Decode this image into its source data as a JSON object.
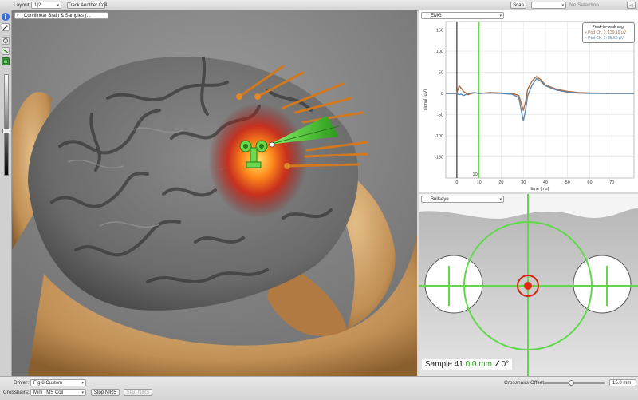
{
  "toolbar": {
    "layout_label": "Layout:",
    "layout_value": "1|2",
    "track_button": "Track Another Coil",
    "scan_button": "Scan",
    "scan_select": "",
    "selection_status": "No Selection"
  },
  "viewport": {
    "view_select": "Curvilinear Brain & Samples (..."
  },
  "emg": {
    "view_select": "EMG",
    "ylabel": "signal (μV)",
    "xlabel": "time (ms)",
    "marker_label": "10",
    "legend_title": "Peak-to-peak avg.",
    "legend_ch1": "Pod Ch. 1: 139.16 μV",
    "legend_ch2": "Pod Ch. 2: 85.59 μV"
  },
  "chart_data": {
    "type": "line",
    "title": "",
    "xlabel": "time (ms)",
    "ylabel": "signal (μV)",
    "xlim": [
      -5,
      80
    ],
    "ylim": [
      -200,
      170
    ],
    "xticks": [
      0,
      10,
      20,
      30,
      40,
      50,
      60,
      70
    ],
    "yticks": [
      150,
      100,
      50,
      0,
      -50,
      -100,
      -150
    ],
    "marker_x": 10,
    "grid": true,
    "legend_position": "top-right",
    "series": [
      {
        "name": "Pod Ch. 1",
        "color": "#b06a3a",
        "x": [
          -5,
          -1,
          0,
          1,
          2,
          3,
          5,
          8,
          10,
          15,
          20,
          25,
          28,
          30,
          31,
          32,
          34,
          36,
          38,
          40,
          45,
          50,
          55,
          60,
          70,
          80
        ],
        "y": [
          0,
          0,
          1,
          18,
          12,
          5,
          -3,
          2,
          0,
          2,
          1,
          0,
          -5,
          -40,
          -20,
          10,
          30,
          40,
          32,
          20,
          10,
          5,
          2,
          1,
          0,
          0
        ]
      },
      {
        "name": "Pod Ch. 2",
        "color": "#5b87b0",
        "x": [
          -5,
          -1,
          0,
          1,
          2,
          3,
          5,
          8,
          10,
          15,
          20,
          25,
          28,
          30,
          31,
          32,
          34,
          36,
          38,
          40,
          45,
          50,
          55,
          60,
          70,
          80
        ],
        "y": [
          0,
          0,
          0,
          -3,
          -2,
          -5,
          0,
          2,
          0,
          1,
          0,
          -2,
          -10,
          -65,
          -40,
          -5,
          20,
          35,
          28,
          18,
          8,
          3,
          1,
          0,
          0,
          0
        ]
      }
    ]
  },
  "bullseye": {
    "view_select": "Bullseye",
    "sample_name": "Sample 41",
    "distance": "0.0 mm",
    "angle": "∠0°"
  },
  "bottom": {
    "driver_label": "Driver:",
    "driver_value": "Fig-8 Custom",
    "crosshairs_label": "Crosshairs:",
    "crosshairs_value": "Mini TMS Coil",
    "stop_button": "Stop NIRS",
    "start_button": "Start NIRS",
    "offset_label": "Crosshairs Offset:",
    "offset_value": "15.0 mm",
    "offset_fraction": 0.45
  },
  "colors": {
    "green": "#5fd84a",
    "orange": "#d2781f",
    "bone": "#c89a62",
    "target_red": "#e02a14"
  }
}
